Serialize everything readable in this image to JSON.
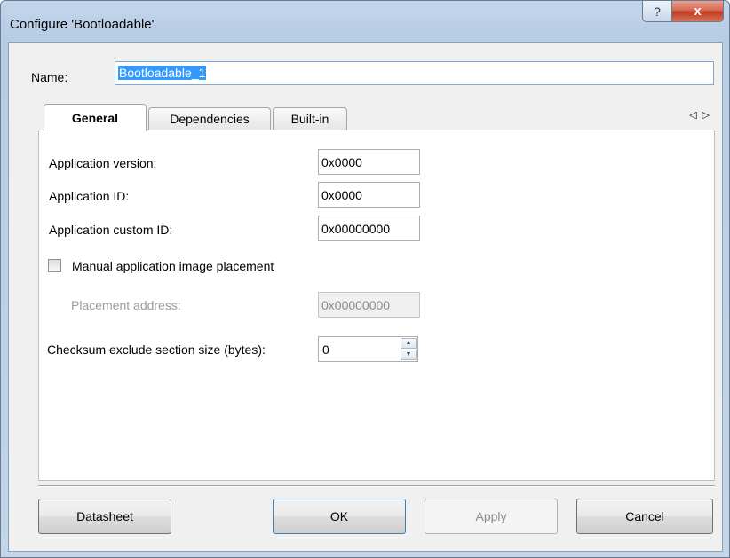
{
  "window": {
    "title": "Configure 'Bootloadable'",
    "help_glyph": "?",
    "close_glyph": "x"
  },
  "name": {
    "label": "Name:",
    "value": "Bootloadable_1"
  },
  "tabs": [
    {
      "label": "General",
      "active": true
    },
    {
      "label": "Dependencies",
      "active": false
    },
    {
      "label": "Built-in",
      "active": false
    }
  ],
  "tab_scroll": {
    "left_glyph": "◁",
    "right_glyph": "▷"
  },
  "general": {
    "app_version": {
      "label": "Application version:",
      "value": "0x0000"
    },
    "app_id": {
      "label": "Application ID:",
      "value": "0x0000"
    },
    "app_custom_id": {
      "label": "Application custom ID:",
      "value": "0x00000000"
    },
    "manual_placement": {
      "label": "Manual application image placement",
      "checked": false
    },
    "placement_address": {
      "label": "Placement address:",
      "value": "0x00000000",
      "enabled": false
    },
    "checksum_exclude": {
      "label": "Checksum exclude section size (bytes):",
      "value": "0"
    }
  },
  "buttons": {
    "datasheet": "Datasheet",
    "ok": "OK",
    "apply": "Apply",
    "cancel": "Cancel"
  },
  "colors": {
    "selection": "#3399ff",
    "close_button": "#c0391d",
    "frame": "#b7cde6"
  }
}
